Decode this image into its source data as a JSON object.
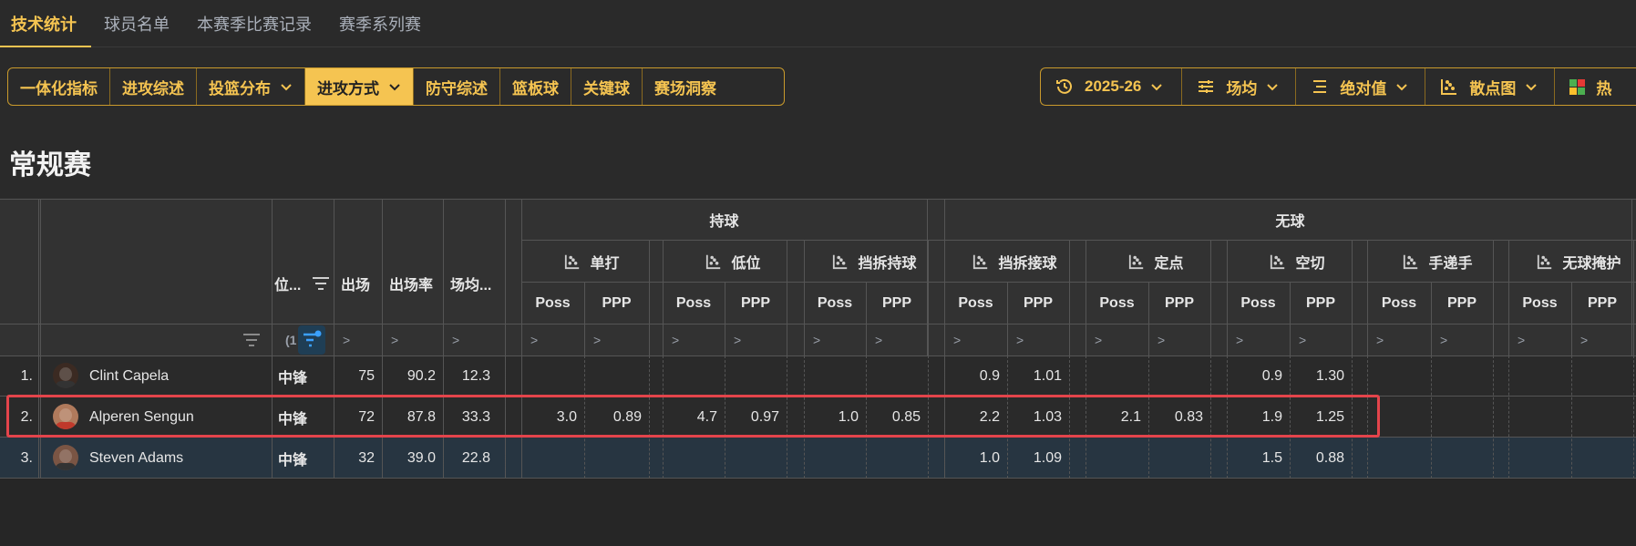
{
  "tabs": [
    "技术统计",
    "球员名单",
    "本赛季比赛记录",
    "赛季系列赛"
  ],
  "left_toolbar": [
    {
      "label": "一体化指标",
      "active": false,
      "dropdown": false
    },
    {
      "label": "进攻综述",
      "active": false,
      "dropdown": false
    },
    {
      "label": "投篮分布",
      "active": false,
      "dropdown": true
    },
    {
      "label": "进攻方式",
      "active": true,
      "dropdown": true
    },
    {
      "label": "防守综述",
      "active": false,
      "dropdown": false
    },
    {
      "label": "篮板球",
      "active": false,
      "dropdown": false
    },
    {
      "label": "关键球",
      "active": false,
      "dropdown": false
    },
    {
      "label": "赛场洞察",
      "active": false,
      "dropdown": false
    }
  ],
  "right_toolbar": [
    {
      "label": "2025-26",
      "icon": "history-icon"
    },
    {
      "label": "场均",
      "icon": "sliders-icon"
    },
    {
      "label": "绝对值",
      "icon": "list-icon"
    },
    {
      "label": "散点图",
      "icon": "scatter-icon"
    },
    {
      "label": "热",
      "icon": "heatmap-icon"
    }
  ],
  "section_title": "常规赛",
  "table": {
    "group_headers": [
      "持球",
      "无球"
    ],
    "fixed_headers": [
      "位...",
      "出场",
      "出场率",
      "场均..."
    ],
    "play_types": [
      "单打",
      "低位",
      "挡拆持球",
      "挡拆接球",
      "定点",
      "空切",
      "手递手",
      "无球掩护"
    ],
    "sub_headers": [
      "Poss",
      "PPP"
    ],
    "filter_hint": ">",
    "position_filter_text": "(1",
    "rows": [
      {
        "rank": "1.",
        "name": "Clint Capela",
        "pos": "中锋",
        "gp": "75",
        "gp_pct": "90.2",
        "min": "12.3",
        "stats": [
          "",
          "",
          "",
          "",
          "",
          "",
          "0.9",
          "1.01",
          "",
          "",
          "0.9",
          "1.30",
          "",
          "",
          "",
          ""
        ]
      },
      {
        "rank": "2.",
        "name": "Alperen Sengun",
        "pos": "中锋",
        "gp": "72",
        "gp_pct": "87.8",
        "min": "33.3",
        "stats": [
          "3.0",
          "0.89",
          "4.7",
          "0.97",
          "1.0",
          "0.85",
          "2.2",
          "1.03",
          "2.1",
          "0.83",
          "1.9",
          "1.25",
          "",
          "",
          "",
          ""
        ]
      },
      {
        "rank": "3.",
        "name": "Steven Adams",
        "pos": "中锋",
        "gp": "32",
        "gp_pct": "39.0",
        "min": "22.8",
        "stats": [
          "",
          "",
          "",
          "",
          "",
          "",
          "1.0",
          "1.09",
          "",
          "",
          "1.5",
          "0.88",
          "",
          "",
          "",
          ""
        ]
      }
    ]
  },
  "colors": {
    "accent": "#f5c451",
    "highlight_border": "#e4444b",
    "bg": "#2a2a2a",
    "row_selected": "#273541"
  }
}
